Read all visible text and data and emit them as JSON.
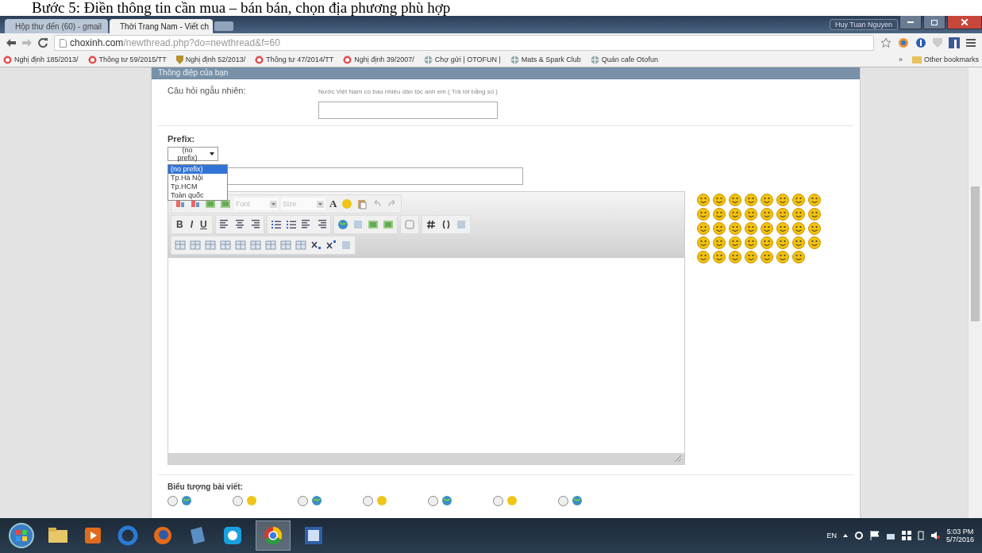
{
  "caption": "Bước 5: Điền thông tin cần mua – bán bán, chọn địa phương phù hợp",
  "browser": {
    "tabs": [
      {
        "label": "Hộp thư đến (60) - gmail",
        "selected": false
      },
      {
        "label": "Thời Trang Nam - Viết ch",
        "selected": true
      }
    ],
    "profile": "Huy Tuan Nguyen",
    "address": {
      "host": "choxinh.com",
      "path": "/newthread.php?do=newthread&f=60"
    },
    "bookmarks": [
      {
        "label": "Nghị định 185/2013/",
        "kind": "pdf"
      },
      {
        "label": "Thông tư 59/2015/TT",
        "kind": "pdf"
      },
      {
        "label": "Nghị định 52/2013/",
        "kind": "shield"
      },
      {
        "label": "Thông tư 47/2014/TT",
        "kind": "pdf"
      },
      {
        "label": "Nghị định 39/2007/",
        "kind": "pdf"
      },
      {
        "label": "Chợ gửi | OTOFUN |",
        "kind": "globe"
      },
      {
        "label": "Mats & Spark Club",
        "kind": "globe"
      },
      {
        "label": "Quán cafe Otofun",
        "kind": "globe"
      }
    ],
    "bookmarks_more": "»",
    "other_bookmarks": "Other bookmarks"
  },
  "form": {
    "section_title": "Thông điệp của bạn",
    "question_label": "Câu hỏi ngẫu nhiên:",
    "question_text": "Nước Việt Nam có bao nhiêu dân tộc anh em ( Trả lời bằng số )",
    "prefix_label": "Prefix:",
    "prefix_value": "(no prefix)",
    "prefix_options": [
      {
        "label": "(no prefix)",
        "selected": true
      },
      {
        "label": "Tp.Hà Nội",
        "selected": false
      },
      {
        "label": "Tp.HCM",
        "selected": false
      },
      {
        "label": "Toàn quốc",
        "selected": false
      }
    ],
    "editor": {
      "font": "Font",
      "size": "Size",
      "font_color": "A",
      "format_buttons": [
        "B",
        "I",
        "U"
      ]
    },
    "post_icons_label": "Biểu tượng bài viết:",
    "post_icons": [
      {
        "selected": false
      },
      {
        "selected": false
      },
      {
        "selected": false
      },
      {
        "selected": false
      },
      {
        "selected": false
      },
      {
        "selected": false
      },
      {
        "selected": false
      }
    ]
  },
  "taskbar": {
    "language": "EN",
    "time": "5:03 PM",
    "date": "5/7/2016"
  }
}
